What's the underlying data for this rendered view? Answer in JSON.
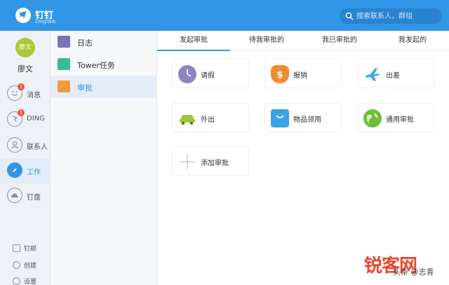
{
  "app": {
    "title": "钉钉",
    "subtitle": "DingTalk",
    "search_placeholder": "搜索联系人，群组"
  },
  "user": {
    "avatar_text": "廖文",
    "name": "廖文"
  },
  "leftnav": {
    "items": [
      {
        "label": "消息",
        "badge": "1"
      },
      {
        "label": "DING",
        "badge": "1"
      },
      {
        "label": "联系人"
      },
      {
        "label": "工作"
      },
      {
        "label": "钉盘"
      }
    ],
    "bottom": [
      {
        "label": "钉邮"
      },
      {
        "label": "创建"
      },
      {
        "label": "设置"
      }
    ]
  },
  "subnav": {
    "items": [
      {
        "label": "日志",
        "color": "#7b72b8"
      },
      {
        "label": "Tower任务",
        "color": "#3bb89a"
      },
      {
        "label": "审批",
        "color": "#f39a3b"
      }
    ]
  },
  "tabs": [
    {
      "label": "发起审批"
    },
    {
      "label": "待我审批的"
    },
    {
      "label": "我已审批的"
    },
    {
      "label": "我发起的"
    }
  ],
  "cards": [
    {
      "label": "请假",
      "icon": "clock-icon",
      "color": "#8e84c0"
    },
    {
      "label": "报销",
      "icon": "money-bag-icon",
      "color": "#f08c2e"
    },
    {
      "label": "出差",
      "icon": "airplane-icon",
      "color": "#40a9e0"
    },
    {
      "label": "外出",
      "icon": "car-icon",
      "color": "#a2c53a"
    },
    {
      "label": "物品领用",
      "icon": "shopping-bag-icon",
      "color": "#3aa3e8"
    },
    {
      "label": "通用审批",
      "icon": "globe-icon",
      "color": "#6cbf3a"
    },
    {
      "label": "添加审批",
      "icon": "plus-icon",
      "color": "#cccccc"
    }
  ],
  "watermark": {
    "brand": "锐客网",
    "author": "头条 @志青"
  },
  "colors": {
    "accent": "#3296e8",
    "badge": "#f0523d"
  }
}
